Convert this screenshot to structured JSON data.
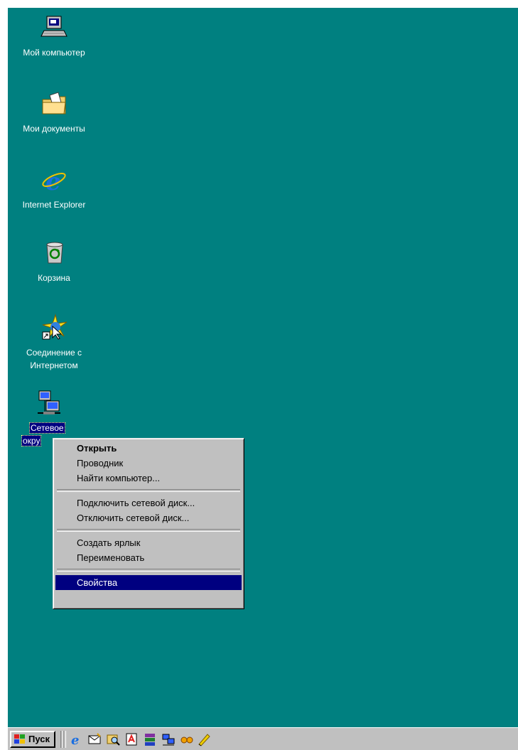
{
  "desktop": {
    "icons": [
      {
        "label": "Мой компьютер",
        "icon": "my-computer-icon"
      },
      {
        "label": "Мои документы",
        "icon": "my-documents-icon"
      },
      {
        "label": "Internet Explorer",
        "icon": "internet-explorer-icon"
      },
      {
        "label": "Корзина",
        "icon": "recycle-bin-icon"
      },
      {
        "label_line1": "Соединение с",
        "label_line2": "Интернетом",
        "icon": "internet-connection-wizard-icon"
      },
      {
        "label": "Сетевое окружение",
        "label_visible": "Сетевое",
        "label_visible2": "окру",
        "icon": "network-neighborhood-icon",
        "selected": true
      }
    ],
    "background_color": "#008080"
  },
  "context_menu": {
    "items": [
      {
        "label": "Открыть",
        "bold": true
      },
      {
        "label": "Проводник"
      },
      {
        "label": "Найти компьютер..."
      },
      {
        "label": "Подключить сетевой диск..."
      },
      {
        "label": "Отключить сетевой диск..."
      },
      {
        "label": "Создать ярлык"
      },
      {
        "label": "Переименовать"
      },
      {
        "label": "Свойства",
        "highlighted": true
      }
    ],
    "highlight_color": "#000080"
  },
  "taskbar": {
    "start_label": "Пуск",
    "quick_launch": [
      "internet-explorer-icon",
      "outlook-express-icon",
      "find-icon",
      "adobe-acrobat-icon",
      "winrar-icon",
      "network-icon",
      "glasses-icon",
      "pen-icon"
    ]
  }
}
